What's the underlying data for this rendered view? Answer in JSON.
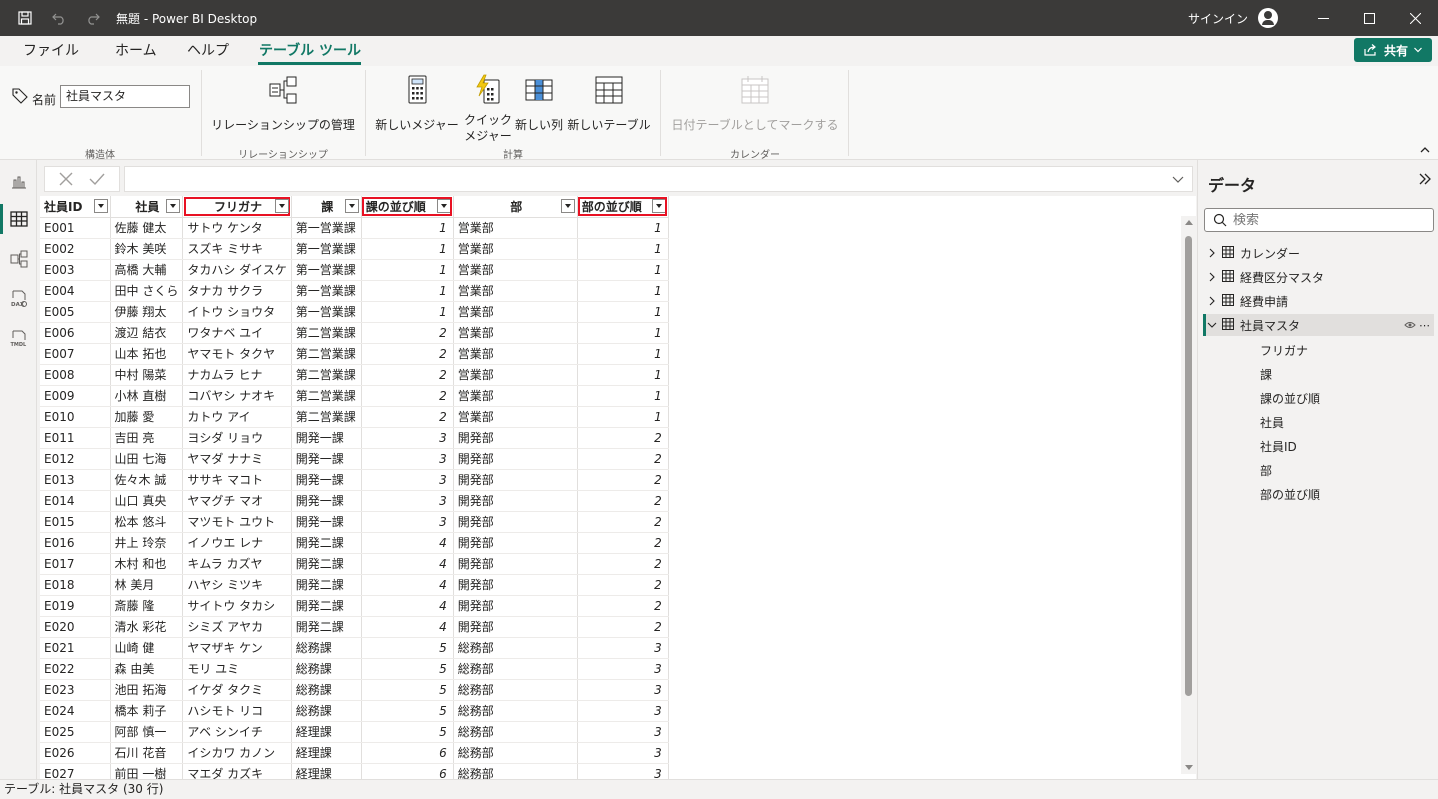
{
  "window": {
    "title": "無題 - Power BI Desktop",
    "signin": "サインイン"
  },
  "menu": {
    "file": "ファイル",
    "home": "ホーム",
    "help": "ヘルプ",
    "table_tools": "テーブル ツール",
    "share": "共有"
  },
  "ribbon": {
    "name_label": "名前",
    "name_value": "社員マスタ",
    "manage_relationships": "リレーションシップの管理",
    "new_measure": "新しいメジャー",
    "quick_measure_1": "クイック",
    "quick_measure_2": "メジャー",
    "new_column": "新しい列",
    "new_table": "新しいテーブル",
    "mark_as_date": "日付テーブルとしてマークする",
    "groups": {
      "structure": "構造体",
      "relationships": "リレーションシップ",
      "calculations": "計算",
      "calendar": "カレンダー"
    }
  },
  "grid": {
    "columns": [
      "社員ID",
      "社員",
      "フリガナ",
      "課",
      "課の並び順",
      "部",
      "部の並び順"
    ],
    "rows": [
      [
        "E001",
        "佐藤 健太",
        "サトウ ケンタ",
        "第一営業課",
        "1",
        "営業部",
        "1"
      ],
      [
        "E002",
        "鈴木 美咲",
        "スズキ ミサキ",
        "第一営業課",
        "1",
        "営業部",
        "1"
      ],
      [
        "E003",
        "高橋 大輔",
        "タカハシ ダイスケ",
        "第一営業課",
        "1",
        "営業部",
        "1"
      ],
      [
        "E004",
        "田中 さくら",
        "タナカ サクラ",
        "第一営業課",
        "1",
        "営業部",
        "1"
      ],
      [
        "E005",
        "伊藤 翔太",
        "イトウ ショウタ",
        "第一営業課",
        "1",
        "営業部",
        "1"
      ],
      [
        "E006",
        "渡辺 結衣",
        "ワタナベ ユイ",
        "第二営業課",
        "2",
        "営業部",
        "1"
      ],
      [
        "E007",
        "山本 拓也",
        "ヤマモト タクヤ",
        "第二営業課",
        "2",
        "営業部",
        "1"
      ],
      [
        "E008",
        "中村 陽菜",
        "ナカムラ ヒナ",
        "第二営業課",
        "2",
        "営業部",
        "1"
      ],
      [
        "E009",
        "小林 直樹",
        "コバヤシ ナオキ",
        "第二営業課",
        "2",
        "営業部",
        "1"
      ],
      [
        "E010",
        "加藤 愛",
        "カトウ アイ",
        "第二営業課",
        "2",
        "営業部",
        "1"
      ],
      [
        "E011",
        "吉田 亮",
        "ヨシダ リョウ",
        "開発一課",
        "3",
        "開発部",
        "2"
      ],
      [
        "E012",
        "山田 七海",
        "ヤマダ ナナミ",
        "開発一課",
        "3",
        "開発部",
        "2"
      ],
      [
        "E013",
        "佐々木 誠",
        "ササキ マコト",
        "開発一課",
        "3",
        "開発部",
        "2"
      ],
      [
        "E014",
        "山口 真央",
        "ヤマグチ マオ",
        "開発一課",
        "3",
        "開発部",
        "2"
      ],
      [
        "E015",
        "松本 悠斗",
        "マツモト ユウト",
        "開発一課",
        "3",
        "開発部",
        "2"
      ],
      [
        "E016",
        "井上 玲奈",
        "イノウエ レナ",
        "開発二課",
        "4",
        "開発部",
        "2"
      ],
      [
        "E017",
        "木村 和也",
        "キムラ カズヤ",
        "開発二課",
        "4",
        "開発部",
        "2"
      ],
      [
        "E018",
        "林 美月",
        "ハヤシ ミツキ",
        "開発二課",
        "4",
        "開発部",
        "2"
      ],
      [
        "E019",
        "斎藤 隆",
        "サイトウ タカシ",
        "開発二課",
        "4",
        "開発部",
        "2"
      ],
      [
        "E020",
        "清水 彩花",
        "シミズ アヤカ",
        "開発二課",
        "4",
        "開発部",
        "2"
      ],
      [
        "E021",
        "山崎 健",
        "ヤマザキ ケン",
        "総務課",
        "5",
        "総務部",
        "3"
      ],
      [
        "E022",
        "森 由美",
        "モリ ユミ",
        "総務課",
        "5",
        "総務部",
        "3"
      ],
      [
        "E023",
        "池田 拓海",
        "イケダ タクミ",
        "総務課",
        "5",
        "総務部",
        "3"
      ],
      [
        "E024",
        "橋本 莉子",
        "ハシモト リコ",
        "総務課",
        "5",
        "総務部",
        "3"
      ],
      [
        "E025",
        "阿部 慎一",
        "アベ シンイチ",
        "経理課",
        "5",
        "総務部",
        "3"
      ],
      [
        "E026",
        "石川 花音",
        "イシカワ カノン",
        "経理課",
        "6",
        "総務部",
        "3"
      ],
      [
        "E027",
        "前田 一樹",
        "マエダ カズキ",
        "経理課",
        "6",
        "総務部",
        "3"
      ]
    ]
  },
  "data_pane": {
    "title": "データ",
    "search_placeholder": "検索",
    "tables": [
      "カレンダー",
      "経費区分マスタ",
      "経費申請",
      "社員マスタ"
    ],
    "fields": [
      "フリガナ",
      "課",
      "課の並び順",
      "社員",
      "社員ID",
      "部",
      "部の並び順"
    ]
  },
  "status": "テーブル: 社員マスタ (30 行)",
  "colors": {
    "accent": "#117865",
    "highlight": "#e81123",
    "titlebar": "#3b3a39"
  }
}
